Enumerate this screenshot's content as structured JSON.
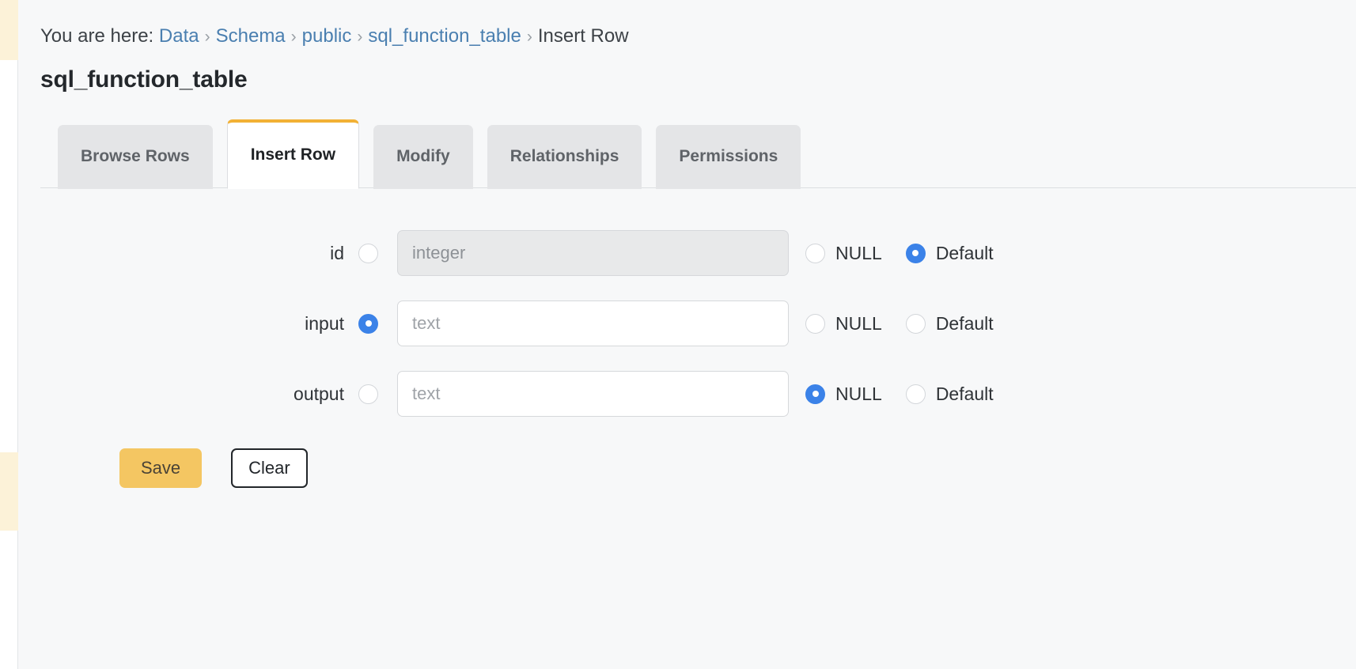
{
  "breadcrumb": {
    "prefix": "You are here:",
    "separator": "›",
    "items": [
      {
        "label": "Data",
        "link": true
      },
      {
        "label": "Schema",
        "link": true
      },
      {
        "label": "public",
        "link": true
      },
      {
        "label": "sql_function_table",
        "link": true
      },
      {
        "label": "Insert Row",
        "link": false
      }
    ]
  },
  "page": {
    "title": "sql_function_table"
  },
  "tabs": [
    {
      "label": "Browse Rows",
      "active": false
    },
    {
      "label": "Insert Row",
      "active": true
    },
    {
      "label": "Modify",
      "active": false
    },
    {
      "label": "Relationships",
      "active": false
    },
    {
      "label": "Permissions",
      "active": false
    }
  ],
  "form": {
    "rows": [
      {
        "label": "id",
        "value_selected": false,
        "value": "",
        "placeholder": "integer",
        "disabled": true,
        "null_label": "NULL",
        "null_selected": false,
        "default_label": "Default",
        "default_selected": true
      },
      {
        "label": "input",
        "value_selected": true,
        "value": "",
        "placeholder": "text",
        "disabled": false,
        "null_label": "NULL",
        "null_selected": false,
        "default_label": "Default",
        "default_selected": false
      },
      {
        "label": "output",
        "value_selected": false,
        "value": "",
        "placeholder": "text",
        "disabled": false,
        "null_label": "NULL",
        "null_selected": true,
        "default_label": "Default",
        "default_selected": false
      }
    ],
    "save_label": "Save",
    "clear_label": "Clear"
  },
  "colors": {
    "accent": "#f2b135",
    "link": "#4a7fb0",
    "radio_selected": "#3b82e8",
    "save_button": "#f4c662",
    "page_background": "#f7f8f9",
    "rail_highlight": "#fcf2d8"
  }
}
